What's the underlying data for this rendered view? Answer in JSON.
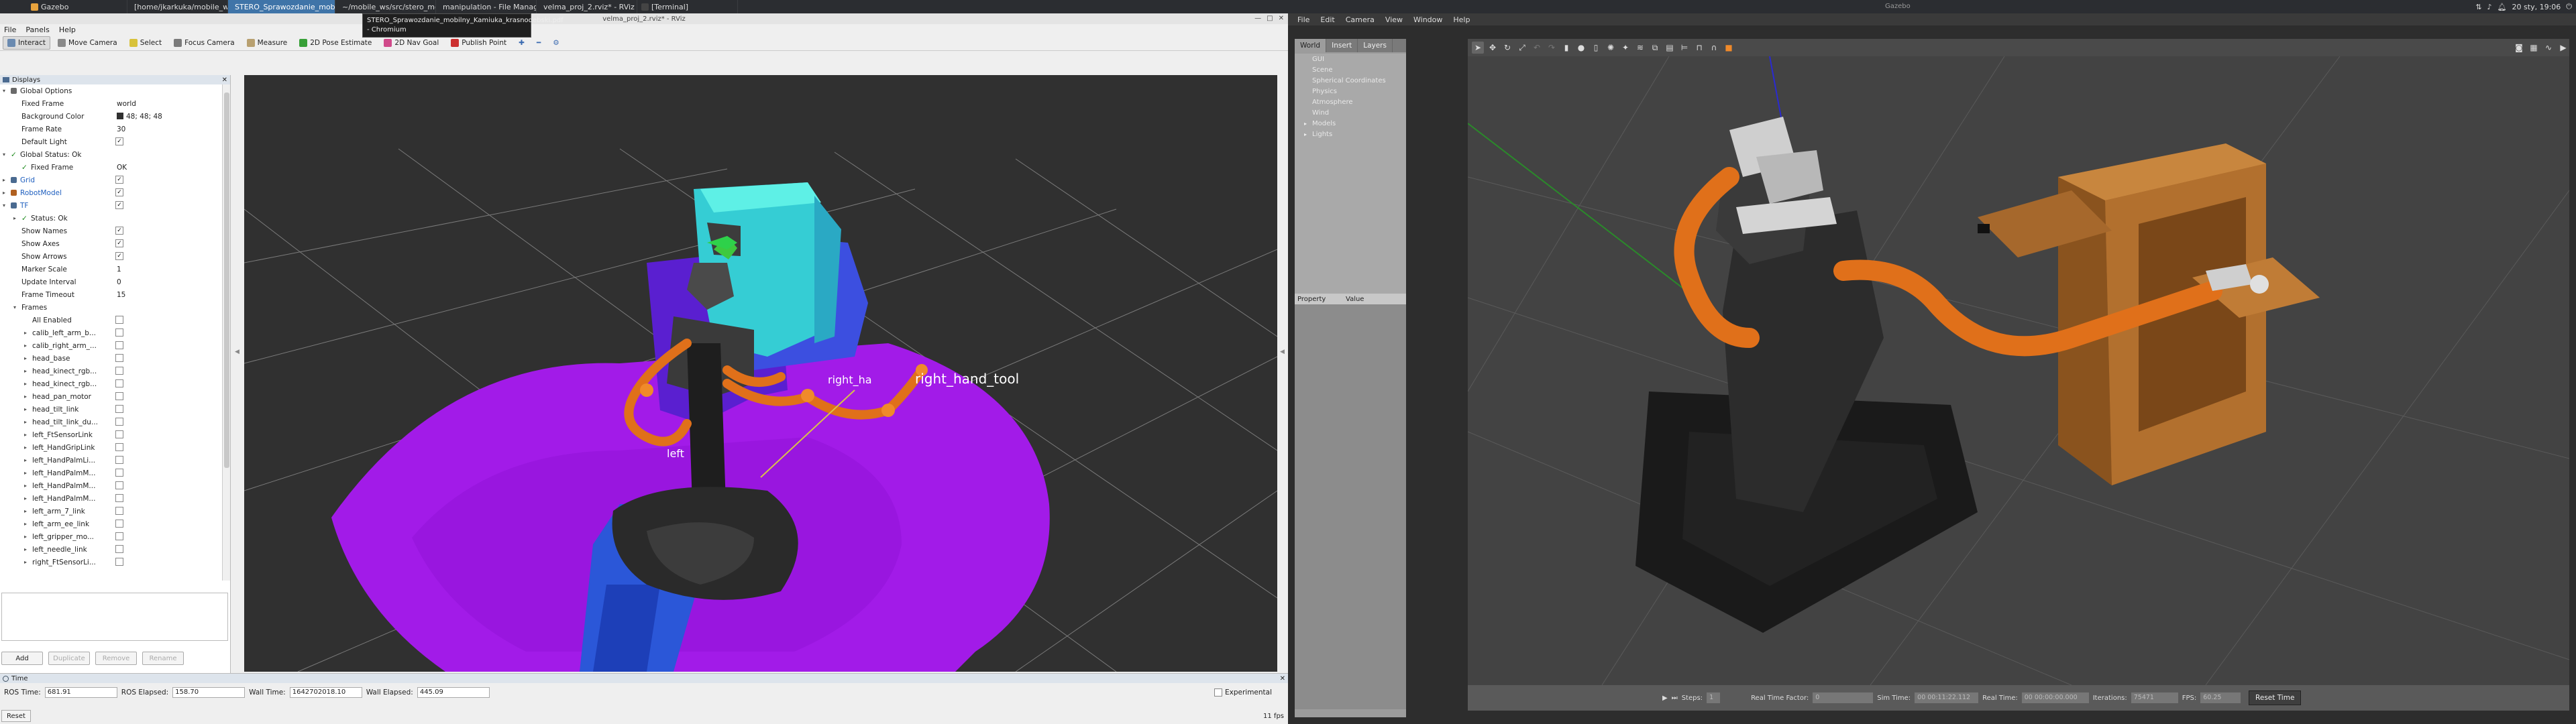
{
  "taskbar": {
    "tasks": [
      {
        "label": "Gazebo",
        "color": "#e8a33d",
        "active": false
      },
      {
        "label": "[home/jkarkuka/mobile_wo...",
        "color": "#7aa2d8",
        "active": false
      },
      {
        "label": "STERO_Sprawozdanie_mobil...",
        "color": "#4a8fd9",
        "active": true
      },
      {
        "label": "~/mobile_ws/src/stero_mobil...",
        "color": "#555",
        "active": false
      },
      {
        "label": "manipulation - File Manager",
        "color": "#5b8cc4",
        "active": false
      },
      {
        "label": "velma_proj_2.rviz* - RViz",
        "color": "#3c3c3c",
        "active": false
      },
      {
        "label": "[Terminal]",
        "color": "#444",
        "active": false
      }
    ],
    "clock": "20 sty, 19:06"
  },
  "tooltip": {
    "line1": "STERO_Sprawozdanie_mobilny_Kamiuka_krasnodebski.pdf",
    "line2": "- Chromium"
  },
  "rviz": {
    "title": "velma_proj_2.rviz* - RViz",
    "menu": [
      "File",
      "Panels",
      "Help"
    ],
    "tools": [
      {
        "label": "Interact",
        "icon": "cursor-icon",
        "color": "#6a8ab0",
        "active": true
      },
      {
        "label": "Move Camera",
        "icon": "camera-move-icon",
        "color": "#8a8a8a",
        "active": false
      },
      {
        "label": "Select",
        "icon": "select-icon",
        "color": "#d8c23a",
        "active": false
      },
      {
        "label": "Focus Camera",
        "icon": "crosshair-icon",
        "color": "#7a7a7a",
        "active": false
      },
      {
        "label": "Measure",
        "icon": "ruler-icon",
        "color": "#b8a070",
        "active": false
      },
      {
        "label": "2D Pose Estimate",
        "icon": "green-arrow-icon",
        "color": "#38a038",
        "active": false
      },
      {
        "label": "2D Nav Goal",
        "icon": "pink-arrow-icon",
        "color": "#d04a8a",
        "active": false
      },
      {
        "label": "Publish Point",
        "icon": "red-pin-icon",
        "color": "#cc3030",
        "active": false
      }
    ],
    "displays": {
      "header": "Displays",
      "rows": [
        {
          "indent": 0,
          "arrow": "▾",
          "icon": "gear",
          "name": "Global Options",
          "value": "",
          "check": null
        },
        {
          "indent": 1,
          "arrow": "",
          "icon": "",
          "name": "Fixed Frame",
          "value": "world",
          "check": null
        },
        {
          "indent": 1,
          "arrow": "",
          "icon": "",
          "name": "Background Color",
          "value": "48; 48; 48",
          "check": null
        },
        {
          "indent": 1,
          "arrow": "",
          "icon": "",
          "name": "Frame Rate",
          "value": "30",
          "check": null
        },
        {
          "indent": 1,
          "arrow": "",
          "icon": "",
          "name": "Default Light",
          "value": "",
          "check": "✓"
        },
        {
          "indent": 0,
          "arrow": "▾",
          "icon": "ok",
          "name": "Global Status: Ok",
          "value": "",
          "check": null
        },
        {
          "indent": 1,
          "arrow": "",
          "icon": "ok",
          "name": "Fixed Frame",
          "value": "OK",
          "check": null
        },
        {
          "indent": 0,
          "arrow": "▸",
          "icon": "grid",
          "name": "Grid",
          "value": "",
          "check": "✓",
          "blue": true
        },
        {
          "indent": 0,
          "arrow": "▸",
          "icon": "robot",
          "name": "RobotModel",
          "value": "",
          "check": "✓",
          "blue": true
        },
        {
          "indent": 0,
          "arrow": "▾",
          "icon": "tf",
          "name": "TF",
          "value": "",
          "check": "✓",
          "blue": true
        },
        {
          "indent": 1,
          "arrow": "▸",
          "icon": "ok",
          "name": "Status: Ok",
          "value": "",
          "check": null
        },
        {
          "indent": 1,
          "arrow": "",
          "icon": "",
          "name": "Show Names",
          "value": "",
          "check": "✓"
        },
        {
          "indent": 1,
          "arrow": "",
          "icon": "",
          "name": "Show Axes",
          "value": "",
          "check": "✓"
        },
        {
          "indent": 1,
          "arrow": "",
          "icon": "",
          "name": "Show Arrows",
          "value": "",
          "check": "✓"
        },
        {
          "indent": 1,
          "arrow": "",
          "icon": "",
          "name": "Marker Scale",
          "value": "1",
          "check": null
        },
        {
          "indent": 1,
          "arrow": "",
          "icon": "",
          "name": "Update Interval",
          "value": "0",
          "check": null
        },
        {
          "indent": 1,
          "arrow": "",
          "icon": "",
          "name": "Frame Timeout",
          "value": "15",
          "check": null
        },
        {
          "indent": 1,
          "arrow": "▾",
          "icon": "",
          "name": "Frames",
          "value": "",
          "check": null
        },
        {
          "indent": 2,
          "arrow": "",
          "icon": "",
          "name": "All Enabled",
          "value": "",
          "check": ""
        },
        {
          "indent": 2,
          "arrow": "▸",
          "icon": "",
          "name": "calib_left_arm_b...",
          "value": "",
          "check": ""
        },
        {
          "indent": 2,
          "arrow": "▸",
          "icon": "",
          "name": "calib_right_arm_...",
          "value": "",
          "check": ""
        },
        {
          "indent": 2,
          "arrow": "▸",
          "icon": "",
          "name": "head_base",
          "value": "",
          "check": ""
        },
        {
          "indent": 2,
          "arrow": "▸",
          "icon": "",
          "name": "head_kinect_rgb...",
          "value": "",
          "check": ""
        },
        {
          "indent": 2,
          "arrow": "▸",
          "icon": "",
          "name": "head_kinect_rgb...",
          "value": "",
          "check": ""
        },
        {
          "indent": 2,
          "arrow": "▸",
          "icon": "",
          "name": "head_pan_motor",
          "value": "",
          "check": ""
        },
        {
          "indent": 2,
          "arrow": "▸",
          "icon": "",
          "name": "head_tilt_link",
          "value": "",
          "check": ""
        },
        {
          "indent": 2,
          "arrow": "▸",
          "icon": "",
          "name": "head_tilt_link_du...",
          "value": "",
          "check": ""
        },
        {
          "indent": 2,
          "arrow": "▸",
          "icon": "",
          "name": "left_FtSensorLink",
          "value": "",
          "check": ""
        },
        {
          "indent": 2,
          "arrow": "▸",
          "icon": "",
          "name": "left_HandGripLink",
          "value": "",
          "check": ""
        },
        {
          "indent": 2,
          "arrow": "▸",
          "icon": "",
          "name": "left_HandPalmLi...",
          "value": "",
          "check": ""
        },
        {
          "indent": 2,
          "arrow": "▸",
          "icon": "",
          "name": "left_HandPalmM...",
          "value": "",
          "check": ""
        },
        {
          "indent": 2,
          "arrow": "▸",
          "icon": "",
          "name": "left_HandPalmM...",
          "value": "",
          "check": ""
        },
        {
          "indent": 2,
          "arrow": "▸",
          "icon": "",
          "name": "left_HandPalmM...",
          "value": "",
          "check": ""
        },
        {
          "indent": 2,
          "arrow": "▸",
          "icon": "",
          "name": "left_arm_7_link",
          "value": "",
          "check": ""
        },
        {
          "indent": 2,
          "arrow": "▸",
          "icon": "",
          "name": "left_arm_ee_link",
          "value": "",
          "check": ""
        },
        {
          "indent": 2,
          "arrow": "▸",
          "icon": "",
          "name": "left_gripper_mo...",
          "value": "",
          "check": ""
        },
        {
          "indent": 2,
          "arrow": "▸",
          "icon": "",
          "name": "left_needle_link",
          "value": "",
          "check": ""
        },
        {
          "indent": 2,
          "arrow": "▸",
          "icon": "",
          "name": "right_FtSensorLi...",
          "value": "",
          "check": ""
        }
      ],
      "buttons": [
        {
          "label": "Add",
          "enabled": true
        },
        {
          "label": "Duplicate",
          "enabled": false
        },
        {
          "label": "Remove",
          "enabled": false
        },
        {
          "label": "Rename",
          "enabled": false
        }
      ]
    },
    "viewport": {
      "labels": [
        "right_hand_tool",
        "left",
        "right_ha"
      ]
    },
    "time": {
      "header": "Time",
      "ros_time_label": "ROS Time:",
      "ros_time": "681.91",
      "ros_elapsed_label": "ROS Elapsed:",
      "ros_elapsed": "158.70",
      "wall_time_label": "Wall Time:",
      "wall_time": "1642702018.10",
      "wall_elapsed_label": "Wall Elapsed:",
      "wall_elapsed": "445.09",
      "experimental": "Experimental",
      "reset": "Reset",
      "fps": "11 fps"
    }
  },
  "gazebo": {
    "title": "Gazebo",
    "menu": [
      "File",
      "Edit",
      "Camera",
      "View",
      "Window",
      "Help"
    ],
    "tabs": [
      "World",
      "Insert",
      "Layers"
    ],
    "world_items": [
      {
        "label": "GUI",
        "arrow": ""
      },
      {
        "label": "Scene",
        "arrow": ""
      },
      {
        "label": "Spherical Coordinates",
        "arrow": ""
      },
      {
        "label": "Physics",
        "arrow": ""
      },
      {
        "label": "Atmosphere",
        "arrow": ""
      },
      {
        "label": "Wind",
        "arrow": ""
      },
      {
        "label": "Models",
        "arrow": "▸"
      },
      {
        "label": "Lights",
        "arrow": "▸"
      }
    ],
    "props_header": {
      "property": "Property",
      "value": "Value"
    },
    "bottom": {
      "steps_label": "Steps:",
      "steps_value": "1",
      "rtf_label": "Real Time Factor:",
      "rtf_value": "0",
      "sim_time_label": "Sim Time:",
      "sim_time": "00 00:11:22.112",
      "real_time_label": "Real Time:",
      "real_time": "00 00:00:00.000",
      "iterations_label": "Iterations:",
      "iterations": "75471",
      "fps_label": "FPS:",
      "fps": "60.25",
      "reset_time": "Reset Time"
    }
  }
}
